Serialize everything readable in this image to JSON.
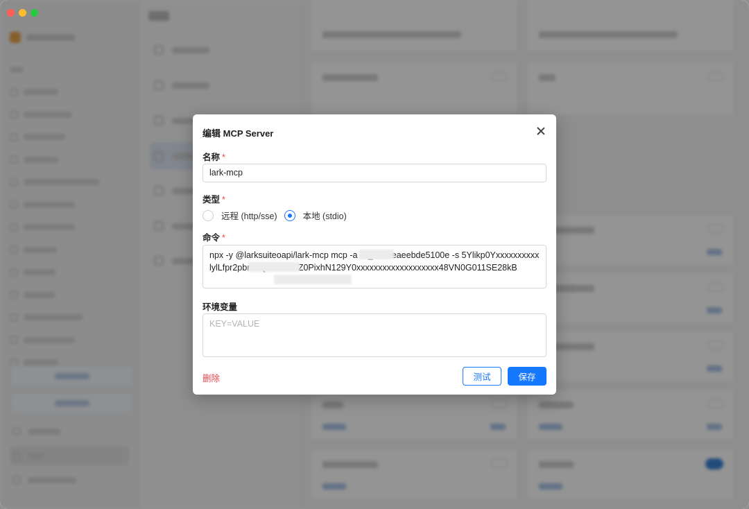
{
  "dialog": {
    "title": "编辑 MCP Server",
    "name_label": "名称",
    "name_value": "lark-mcp",
    "type_label": "类型",
    "type_options": [
      {
        "label": "远程 (http/sse)",
        "selected": false
      },
      {
        "label": "本地 (stdio)",
        "selected": true
      }
    ],
    "command_label": "命令",
    "command_value": "npx -y @larksuiteoapi/lark-mcp mcp -a cli_a7c8eaeebde5100e -s 5Ylikp0YxxxxxxxxxxlylLfpr2pbrndQl -u u-dnZ0PixhN129Y0xxxxxxxxxxxxxxxxxxx48VN0G011SE28kB",
    "env_label": "环境变量",
    "env_placeholder": "KEY=VALUE",
    "required_mark": "*",
    "delete_label": "删除",
    "test_label": "测试",
    "save_label": "保存"
  },
  "colors": {
    "primary": "#1677ff",
    "danger": "#e5484d",
    "overlay": "rgba(0,0,0,0.42)"
  },
  "icons": {
    "close": "close-icon",
    "radio_off": "radio-unchecked-icon",
    "radio_on": "radio-checked-icon"
  }
}
